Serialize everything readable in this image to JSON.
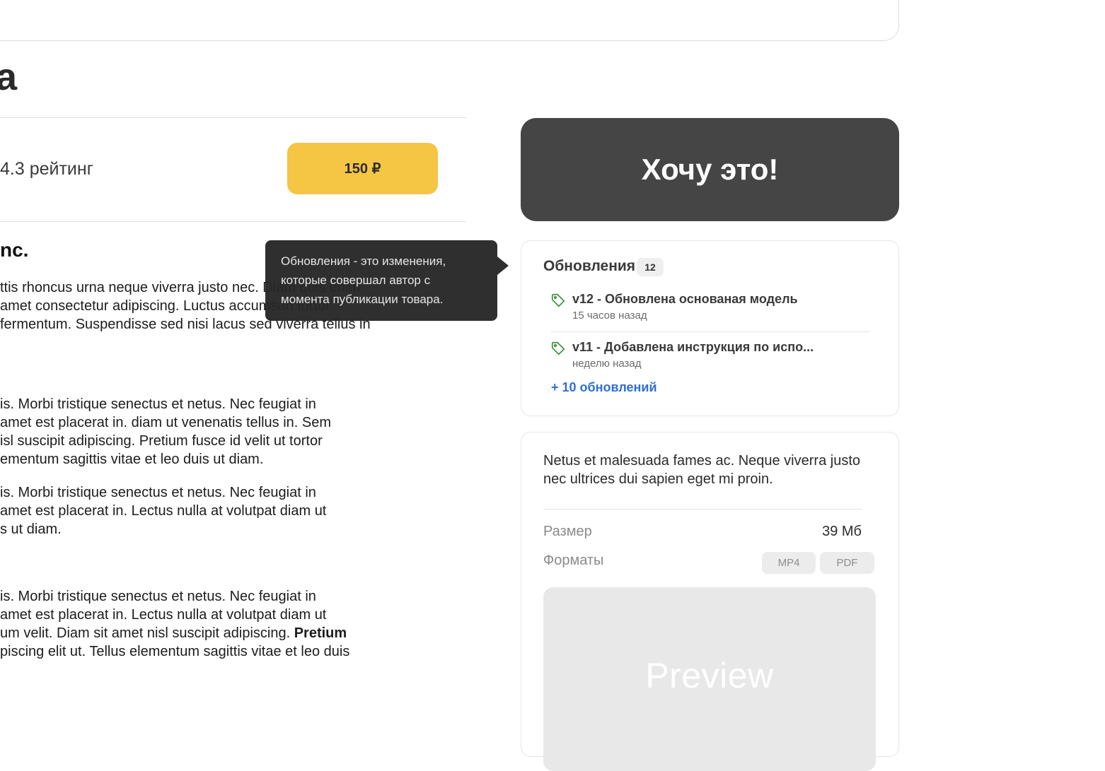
{
  "header": {
    "title_fragment": "a"
  },
  "rating": {
    "text": "4.3 рейтинг"
  },
  "price": {
    "label": "150 ₽"
  },
  "seller": {
    "name_fragment": "nc."
  },
  "description": {
    "p1": [
      "ttis rhoncus urna neque viverra justo nec. Diam quis enim",
      "amet consectetur adipiscing. Luctus accumsan tortor",
      "fermentum. Suspendisse sed nisi lacus sed viverra tellus in"
    ],
    "p2": [
      "is. Morbi tristique senectus et netus. Nec feugiat in",
      "amet est placerat in. diam ut venenatis tellus in. Sem",
      "isl suscipit adipiscing. Pretium fusce id velit ut tortor",
      "ementum sagittis vitae et leo duis ut diam."
    ],
    "p3": [
      "is. Morbi tristique senectus et netus. Nec feugiat in",
      "amet est placerat in. Lectus nulla at volutpat diam ut",
      "s ut diam."
    ],
    "p4": {
      "l1": "is. Morbi tristique senectus et netus. Nec feugiat in",
      "l2": "amet est placerat in. Lectus nulla at volutpat diam ut",
      "l3_start": "um velit. Diam sit amet nisl suscipit adipiscing. ",
      "l3_bold": "Pretium",
      "l4": "piscing elit ut. Tellus elementum sagittis vitae et leo duis"
    }
  },
  "tooltip": {
    "lines": [
      "Обновления - это изменения,",
      "которые совершал автор с",
      "момента публикации товара."
    ]
  },
  "cta": {
    "label": "Хочу это!"
  },
  "updates": {
    "title": "Обновления",
    "count": "12",
    "items": [
      {
        "title": "v12 - Обновлена основаная модель",
        "time": "15 часов назад",
        "icon": "tag-icon"
      },
      {
        "title": "v11 - Добавлена инструкция по испо...",
        "time": "неделю назад",
        "icon": "tag-icon"
      }
    ],
    "more": "+ 10 обновлений",
    "colors": {
      "accent": "#2f6fd6",
      "tag": "#3a8f3a"
    }
  },
  "info": {
    "description": "Netus et malesuada fames ac. Neque viverra justo nec ultrices dui sapien eget mi proin.",
    "size_label": "Размер",
    "size_value": "39 Мб",
    "formats_label": "Форматы",
    "formats": [
      "MP4",
      "PDF"
    ],
    "preview": "Preview"
  },
  "colors": {
    "price_button": "#f5c544",
    "cta": "#454545"
  }
}
